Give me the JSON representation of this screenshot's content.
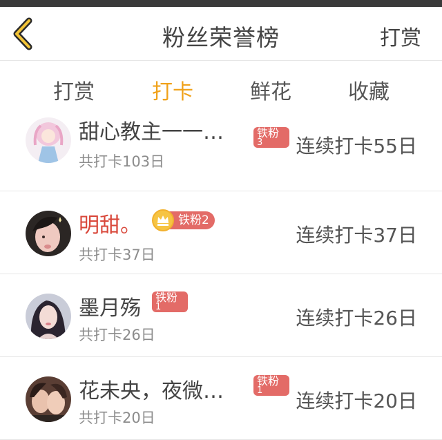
{
  "header": {
    "title": "粉丝荣誉榜",
    "action_label": "打赏",
    "back_icon": "chevron-left-icon"
  },
  "tabs": [
    {
      "label": "打赏",
      "active": false
    },
    {
      "label": "打卡",
      "active": true
    },
    {
      "label": "鲜花",
      "active": false
    },
    {
      "label": "收藏",
      "active": false
    }
  ],
  "colors": {
    "accent": "#f0a21b",
    "badge": "#e36b67",
    "highlight_name": "#d9483b"
  },
  "fans": [
    {
      "name": "甜心教主一一…",
      "badge": "铁粉",
      "level": "3",
      "total": "共打卡103日",
      "streak": "连续打卡55日",
      "has_crown": false
    },
    {
      "name": "明甜。",
      "badge": "铁粉2",
      "level": "",
      "total": "共打卡37日",
      "streak": "连续打卡37日",
      "has_crown": true
    },
    {
      "name": "墨月殇",
      "badge": "铁粉",
      "level": "1",
      "total": "共打卡26日",
      "streak": "连续打卡26日",
      "has_crown": false
    },
    {
      "name": "花未央，夜微…",
      "badge": "铁粉",
      "level": "1",
      "total": "共打卡20日",
      "streak": "连续打卡20日",
      "has_crown": false
    }
  ]
}
